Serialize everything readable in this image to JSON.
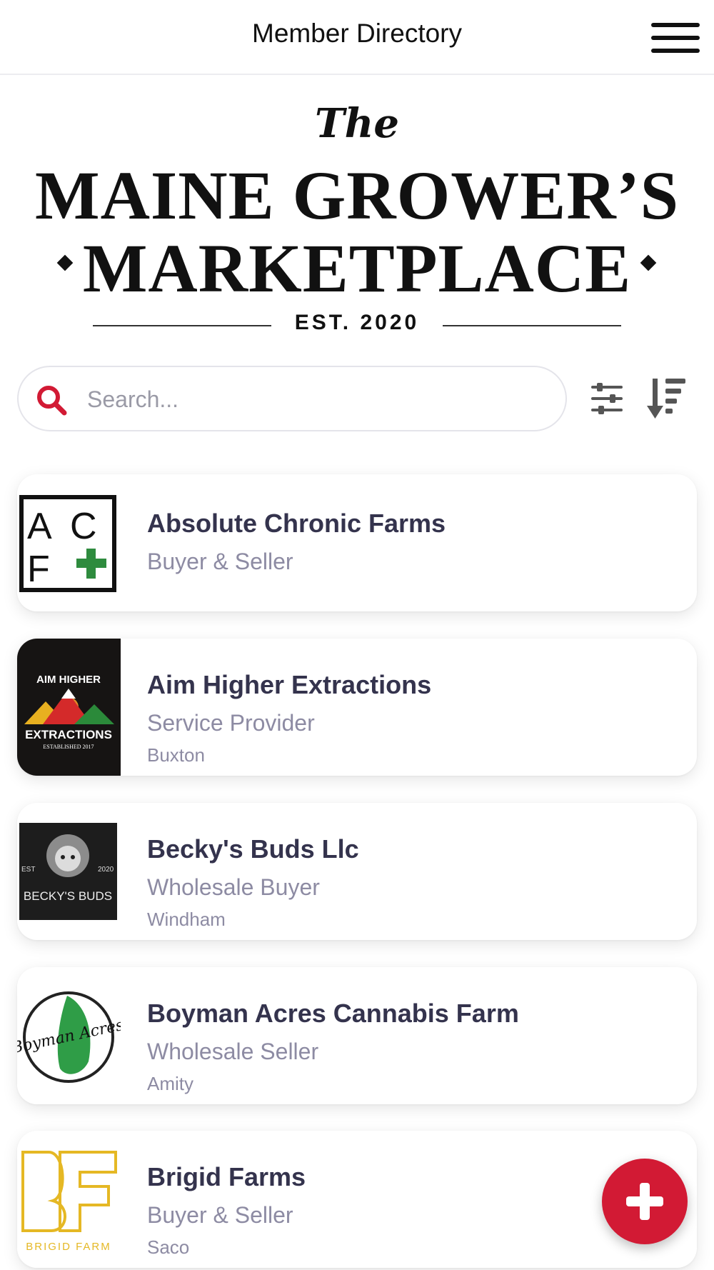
{
  "header": {
    "title": "Member Directory",
    "menu_icon": "hamburger-menu-icon"
  },
  "logo": {
    "the": "The",
    "line1": "MAINE GROWER’S",
    "line2": "MARKETPLACE",
    "est": "EST. 2020"
  },
  "search": {
    "placeholder": "Search...",
    "value": "",
    "icon": "search-icon",
    "filter_icon": "sliders-filter-icon",
    "sort_icon": "sort-descending-icon"
  },
  "colors": {
    "accent": "#d21a34",
    "name_text": "#34334d",
    "secondary_text": "#8d8ba3"
  },
  "members": [
    {
      "name": "Absolute Chronic Farms",
      "role": "Buyer & Seller",
      "city": "",
      "logo_icon": "acf-logo",
      "logo_text": "ACF"
    },
    {
      "name": "Aim Higher Extractions",
      "role": "Service Provider",
      "city": "Buxton",
      "logo_icon": "aim-higher-logo",
      "logo_text_top": "AIM HIGHER",
      "logo_text_main": "EXTRACTIONS",
      "logo_text_sub": "ESTABLISHED 2017"
    },
    {
      "name": "Becky's Buds Llc",
      "role": "Wholesale Buyer",
      "city": "Windham",
      "logo_icon": "beckys-buds-logo",
      "logo_text_est": "EST",
      "logo_text_year": "2020",
      "logo_text_main": "BECKY'S BUDS"
    },
    {
      "name": "Boyman Acres Cannabis Farm",
      "role": "Wholesale Seller",
      "city": "Amity",
      "logo_icon": "boyman-acres-logo",
      "logo_text_main": "Boyman Acres"
    },
    {
      "name": "Brigid Farms",
      "role": "Buyer & Seller",
      "city": "Saco",
      "logo_icon": "brigid-farm-logo",
      "logo_text_main": "BRIGID FARM"
    }
  ],
  "fab": {
    "icon": "plus-icon"
  }
}
